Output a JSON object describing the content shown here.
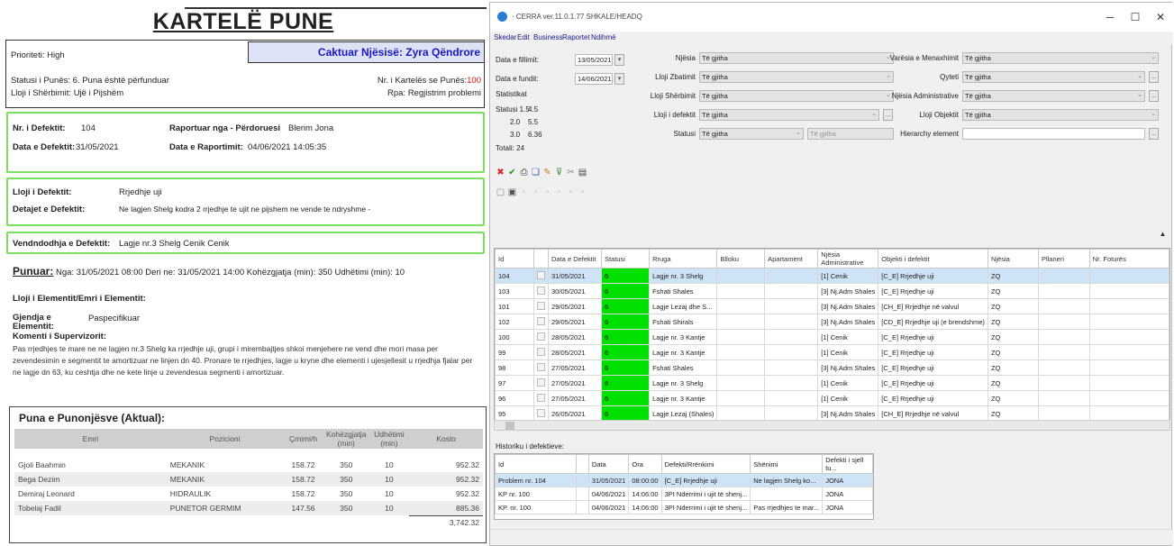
{
  "report": {
    "title": "KARTELË PUNE",
    "assigned": "Caktuar Njësisë: Zyra Qëndrore",
    "priority_label": "Prioriteti:",
    "priority_value": "High",
    "status_line": "Statusi i Punës: 6. Puna është përfunduar",
    "card_no_label": "Nr. i Kartelës se Punës:",
    "card_no_value": "100",
    "type_line": "Lloji i Shërbimit: Ujë i Pijshëm",
    "source_line": "Rpa: Regjistrim problemi",
    "defect_no_label": "Nr. i Defektit:",
    "defect_no_value": "104",
    "reported_by_label": "Raportuar nga - Përdoruesi",
    "reported_by_value": "Blerim Jona",
    "defect_date_label": "Data e Defektit:",
    "defect_date_value": "31/05/2021",
    "report_date_label": "Data e Raportimit:",
    "report_date_value": "04/06/2021 14:05:35",
    "defect_type_label": "Lloji i Defektit:",
    "defect_type_value": "Rrjedhje uji",
    "defect_details_label": "Detajet e Defektit:",
    "defect_details_value": "Ne lagjen Shelg kodra 2 rrjedhje te ujit ne pijshem ne vende te ndryshme -",
    "location_label": "Vendndodhja e Defektit:",
    "location_value": "Lagje nr.3 Shelg Cenik Cenik",
    "work_label": "Punuar:",
    "work_line": "Nga: 31/05/2021 08:00   Deri ne: 31/05/2021 14:00   Kohëzgjatja (min): 350   Udhëtimi (min): 10",
    "element_label": "Lloji i Elementit/Emri i Elementit:",
    "condition_label": "Gjendja e Elementit:",
    "condition_value": "Paspecifikuar",
    "comment_label": "Komenti i Supervizorit:",
    "comment_text": "Pas rrjedhjes te mare ne ne lagjen nr.3 Shelg ka rrjedhje uji, grupi i mirembajtjes shkoi menjehere ne vend dhe mori masa per zevendesimin e segmentit te amortizuar ne linjen dn 40. Pronare te rrjedhjes, lagje u kryne dhe elementi i ujesjellesit u rrjedhja fjalar per ne lagje dn 63, ku ceshtja dhe ne kete linje u zevendesua segmenti i amortizuar.",
    "employees_title": "Puna e Punonjësve (Aktual):",
    "emp_headers": [
      "Emri",
      "Pozicioni",
      "Çmimi/h",
      "Kohëzgjatja (min)",
      "Udhëtimi (min)",
      "Kosto"
    ],
    "employees": [
      {
        "name": "Gjoli Baahmin",
        "position": "MEKANIK",
        "rate": "158.72",
        "duration": "350",
        "travel": "10",
        "cost": "952.32"
      },
      {
        "name": "Bega Dezim",
        "position": "MEKANIK",
        "rate": "158.72",
        "duration": "350",
        "travel": "10",
        "cost": "952.32"
      },
      {
        "name": "Demiraj Leonard",
        "position": "HIDRAULIK",
        "rate": "158.72",
        "duration": "350",
        "travel": "10",
        "cost": "952.32"
      },
      {
        "name": "Tobelaj Fadil",
        "position": "PUNETOR GERMIM",
        "rate": "147.56",
        "duration": "350",
        "travel": "10",
        "cost": "885.36"
      }
    ],
    "total": "3,742.32"
  },
  "app": {
    "title": "· CERRA ver.11.0.1.77   SHKALE/HEADQ",
    "menu": [
      "Skedar",
      "Edit",
      "Business",
      "Raportet",
      "Ndihmë"
    ],
    "date_from_label": "Data e fillimit:",
    "date_from": "13/05/2021",
    "date_to_label": "Data e fundit:",
    "date_to": "14/06/2021",
    "stats_label": "Statistikat",
    "stats": [
      {
        "k": "Statusi 1.5",
        "v": "4.5"
      },
      {
        "k": "2.0",
        "v": "5.5"
      },
      {
        "k": "3.0",
        "v": "6.36"
      },
      {
        "k": "Totali: 24",
        "v": ""
      }
    ],
    "filters_mid": [
      {
        "label": "Njësia",
        "value": "Të gjitha"
      },
      {
        "label": "Lloji Zbatimit",
        "value": "Të gjitha"
      },
      {
        "label": "Lloji Shërbimit",
        "value": "Të gjitha"
      },
      {
        "label": "Lloji i defektit",
        "value": "Të gjitha"
      },
      {
        "label": "Statusi",
        "value": "Të gjitha"
      }
    ],
    "filter_extra": "Të gjitha",
    "filters_right": [
      {
        "label": "Varësia e Menaxhimit",
        "value": "Të gjitha"
      },
      {
        "label": "Qyteti",
        "value": "Të gjitha"
      },
      {
        "label": "Njësia Administrative",
        "value": "Të gjitha"
      },
      {
        "label": "Lloji Objektit",
        "value": "Të gjitha"
      },
      {
        "label": "Hierarchy element",
        "value": ""
      }
    ],
    "grid_headers": [
      "Id",
      "",
      "Data e Defektit",
      "Statusi",
      "Rruga",
      "Blloku",
      "Apartament",
      "Njësia Administrative",
      "Objekti i defektit",
      "Njësia",
      "Pllaneri",
      "Nr. Foturës"
    ],
    "rows": [
      {
        "id": "104",
        "date": "31/05/2021",
        "status": "6",
        "street": "Lagje nr. 3 Shelg",
        "unit": "[1] Cenik",
        "obj": "[C_E] Rrjedhje uji",
        "nj": "ZQ"
      },
      {
        "id": "103",
        "date": "30/05/2021",
        "status": "6",
        "street": "Fshati Shales",
        "unit": "[3] Nj.Adm Shales",
        "obj": "[C_E] Rrjedhje uji",
        "nj": "ZQ"
      },
      {
        "id": "101",
        "date": "29/05/2021",
        "status": "6",
        "street": "Lagje Lezaj dhe S...",
        "unit": "[3] Nj.Adm Shales",
        "obj": "[CH_E] Rrjedhje në valvul",
        "nj": "ZQ"
      },
      {
        "id": "102",
        "date": "29/05/2021",
        "status": "6",
        "street": "Fshati Shirals",
        "unit": "[3] Nj.Adm Shales",
        "obj": "[CD_E] Rrjedhje uji (e brendshme)",
        "nj": "ZQ"
      },
      {
        "id": "100",
        "date": "28/05/2021",
        "status": "6",
        "street": "Lagje nr. 3 Kantje",
        "unit": "[1] Cenik",
        "obj": "[C_E] Rrjedhje uji",
        "nj": "ZQ"
      },
      {
        "id": "99",
        "date": "28/05/2021",
        "status": "6",
        "street": "Lagje nr. 3 Kantje",
        "unit": "[1] Cenik",
        "obj": "[C_E] Rrjedhje uji",
        "nj": "ZQ"
      },
      {
        "id": "98",
        "date": "27/05/2021",
        "status": "6",
        "street": "Fshati Shales",
        "unit": "[3] Nj.Adm Shales",
        "obj": "[C_E] Rrjedhje uji",
        "nj": "ZQ"
      },
      {
        "id": "97",
        "date": "27/05/2021",
        "status": "6",
        "street": "Lagje nr. 3 Shelg",
        "unit": "[1] Cenik",
        "obj": "[C_E] Rrjedhje uji",
        "nj": "ZQ"
      },
      {
        "id": "96",
        "date": "27/05/2021",
        "status": "6",
        "street": "Lagje nr. 3 Kantje",
        "unit": "[1] Cenik",
        "obj": "[C_E] Rrjedhje uji",
        "nj": "ZQ"
      },
      {
        "id": "95",
        "date": "26/05/2021",
        "status": "6",
        "street": "Lagje Lezaj (Shales)",
        "unit": "[3] Nj.Adm Shales",
        "obj": "[CH_E] Rrjedhje në valvul",
        "nj": "ZQ"
      }
    ],
    "history_label": "Historiku i defektieve:",
    "hist_headers": [
      "Id",
      "",
      "Data",
      "Ora",
      "Defekti/Rrënkimi",
      "Shënimi",
      "Defekti i sjell tu..."
    ],
    "hist_rows": [
      {
        "id": "Problem nr. 104",
        "date": "31/05/2021",
        "time": "08:00:00",
        "def": "[C_E] Rrjedhje uji",
        "note": "Ne lagjen Shelg ko...",
        "x": "JONA"
      },
      {
        "id": "KP nr. 100",
        "date": "04/06/2021",
        "time": "14:06:00",
        "def": "3PI Nderrimi i ujit të shenj...",
        "note": "",
        "x": "JONA"
      },
      {
        "id": "KP. nr. 100",
        "date": "04/06/2021",
        "time": "14:06:00",
        "def": "3PI Nderrimi i ujit të shenj...",
        "note": "Pas rrjedhjes te mar...",
        "x": "JONA"
      }
    ]
  }
}
